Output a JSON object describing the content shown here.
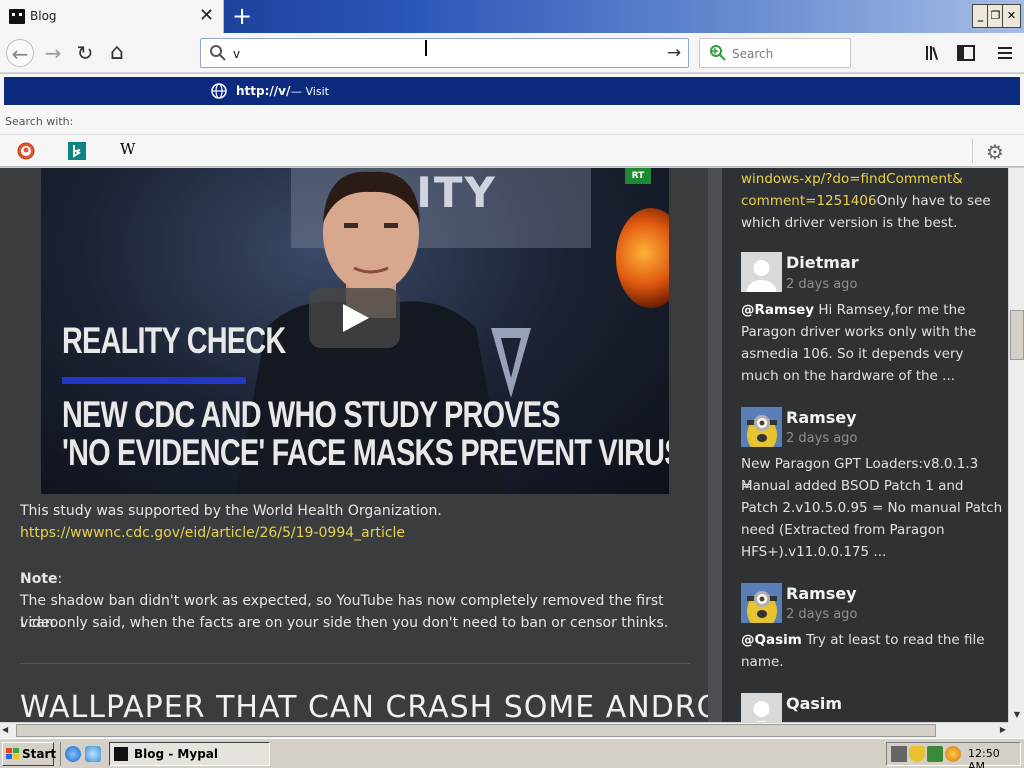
{
  "tab": {
    "title": "Blog",
    "close": "✕",
    "new_tab": "+"
  },
  "window": {
    "minimize": "_",
    "restore": "❐",
    "close": "✕"
  },
  "nav": {
    "back": "←",
    "forward": "→",
    "reload": "↻",
    "home": "⌂",
    "url_value": "v",
    "go": "→",
    "search_placeholder": "Search"
  },
  "dropdown": {
    "suggestion_url": "http://v/",
    "suggestion_sep": "—",
    "suggestion_action": "Visit",
    "search_with_label": "Search with:",
    "engines": [
      "duckduckgo-icon",
      "bing-icon",
      "wikipedia-icon"
    ],
    "wikipedia_glyph": "W",
    "gear": "⚙"
  },
  "video": {
    "banner_text": "ALITY",
    "rt_badge": "RT",
    "reality_check": "REALITY CHECK",
    "headline_1": "NEW CDC AND WHO STUDY PROVES",
    "headline_2": "'NO EVIDENCE' FACE MASKS PREVENT VIRUS"
  },
  "article": {
    "supported_text": "This study was supported by the World Health Organization.",
    "link": "https://wwwnc.cdc.gov/eid/article/26/5/19-0994_article",
    "note_label": "Note",
    "note_colon": ":",
    "note_line1": "The shadow ban didn't work as expected, so YouTube has now completely removed the first video.",
    "note_line2": "I can only said, when the facts are on your side then you don't need to ban or censor thinks.",
    "next_title": "WALLPAPER THAT CAN CRASH SOME ANDROID"
  },
  "comments": {
    "top": {
      "link_line1": "windows-xp/?do=findComment&",
      "link_line2": "comment=1251406",
      "text_line2": "Only have to see",
      "text_line3": "which driver version is the best."
    },
    "items": [
      {
        "name": "Dietmar",
        "date": "2 days ago",
        "mention": "@Ramsey",
        "line1": " Hi Ramsey,for me the",
        "line2": "Paragon driver works only with the",
        "line3": "asmedia 106. So it depends very",
        "line4": "much on the hardware of the ..."
      },
      {
        "name": "Ramsey",
        "date": "2 days ago",
        "line1": "New Paragon GPT Loaders:v8.0.1.3 =",
        "line2": "Manual added BSOD Patch 1 and",
        "line3": "Patch 2.v10.5.0.95 = No manual Patch",
        "line4": "need (Extracted from Paragon",
        "line5": "HFS+).v11.0.0.175 ..."
      },
      {
        "name": "Ramsey",
        "date": "2 days ago",
        "mention": "@Qasim",
        "line1": " Try at least to read the file",
        "line2": "name."
      },
      {
        "name": "Qasim"
      }
    ]
  },
  "taskbar": {
    "start": "Start",
    "task_label": "Blog - Mypal",
    "clock": "12:50 AM"
  },
  "colors": {
    "link": "#e8d14a",
    "accent": "#0c2a7e",
    "page_bg": "#3a3d40"
  }
}
